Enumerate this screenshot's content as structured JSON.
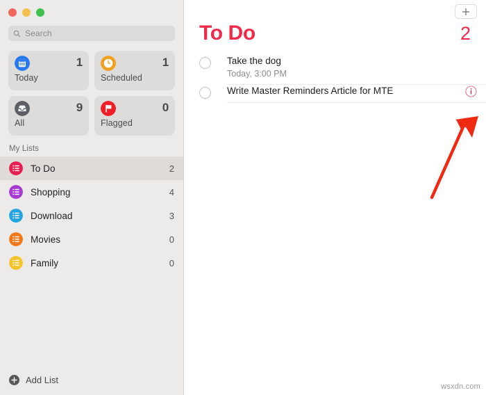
{
  "window": {
    "traffic_lights": [
      {
        "name": "close",
        "color": "#f0655c"
      },
      {
        "name": "minimize",
        "color": "#f5bf4f"
      },
      {
        "name": "maximize",
        "color": "#3fc14c"
      }
    ]
  },
  "sidebar": {
    "search": {
      "placeholder": "Search",
      "value": "",
      "icon": "search-icon"
    },
    "smart_lists": [
      {
        "label": "Today",
        "count": "1",
        "icon": "calendar-icon",
        "color": "#2878f0"
      },
      {
        "label": "Scheduled",
        "count": "1",
        "icon": "clock-icon",
        "color": "#f0a020"
      },
      {
        "label": "All",
        "count": "9",
        "icon": "tray-icon",
        "color": "#5c6066"
      },
      {
        "label": "Flagged",
        "count": "0",
        "icon": "flag-icon",
        "color": "#ef2027"
      }
    ],
    "section_title": "My Lists",
    "lists": [
      {
        "label": "To Do",
        "count": "2",
        "color": "#e91e50",
        "selected": true
      },
      {
        "label": "Shopping",
        "count": "4",
        "color": "#a73ad0",
        "selected": false
      },
      {
        "label": "Download",
        "count": "3",
        "color": "#24a3e0",
        "selected": false
      },
      {
        "label": "Movies",
        "count": "0",
        "color": "#f07818",
        "selected": false
      },
      {
        "label": "Family",
        "count": "0",
        "color": "#f5c42c",
        "selected": false
      }
    ],
    "add_list": {
      "label": "Add List",
      "icon": "plus-circle-icon"
    }
  },
  "main": {
    "add_button": {
      "label": "+",
      "icon": "plus-icon"
    },
    "title": "To Do",
    "count": "2",
    "accent_color": "#ef2b4b",
    "tasks": [
      {
        "title": "Take the dog",
        "subtitle": "Today, 3:00 PM",
        "completed": false,
        "has_info": false
      },
      {
        "title": "Write Master Reminders Article for MTE",
        "subtitle": "",
        "completed": false,
        "has_info": true
      }
    ],
    "annotation": {
      "type": "arrow",
      "color": "#ee2a12",
      "points_to": "info-icon"
    },
    "watermark": "wsxdn.com"
  }
}
